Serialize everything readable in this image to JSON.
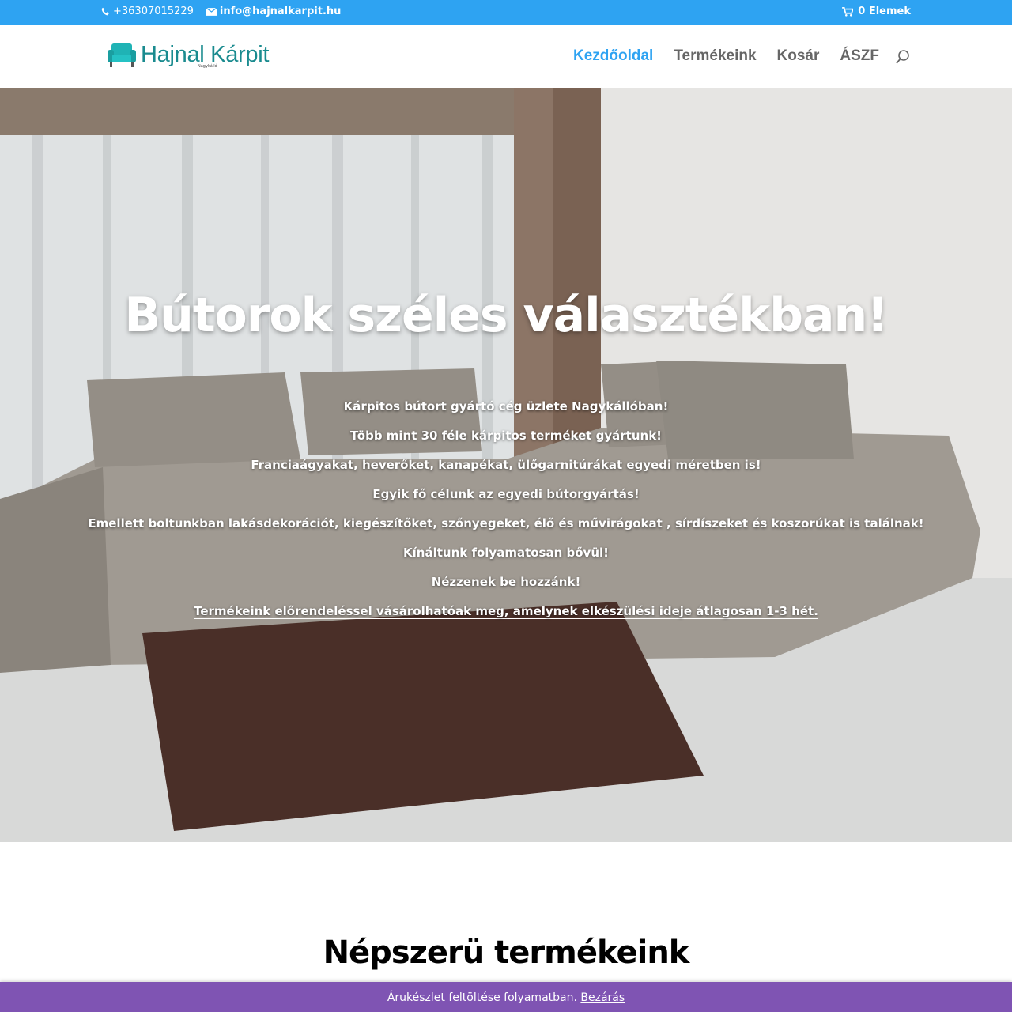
{
  "topbar": {
    "phone": "+36307015229",
    "email": "info@hajnalkarpit.hu",
    "cart_label": "0 Elemek",
    "phone_icon": "phone-icon",
    "email_icon": "envelope-icon",
    "cart_icon": "cart-icon"
  },
  "header": {
    "logo_text": "Hajnal Kárpit",
    "logo_subtext": "Nagykálló",
    "logo_icon": "armchair-icon",
    "nav": [
      {
        "label": "Kezdőoldal",
        "active": true
      },
      {
        "label": "Termékeink",
        "active": false
      },
      {
        "label": "Kosár",
        "active": false
      },
      {
        "label": "ÁSZF",
        "active": false
      }
    ],
    "search_icon": "search-icon"
  },
  "hero": {
    "title": "Bútorok széles választékban!",
    "lines": [
      "Kárpitos bútort gyártó cég üzlete Nagykállóban!",
      "Több mint 30 féle kárpitos terméket gyártunk!",
      "Franciaágyakat, heverőket, kanapékat, ülőgarnitúrákat egyedi méretben is!",
      "Egyik fő célunk az egyedi bútorgyártás!",
      "Emellett boltunkban lakásdekorációt, kiegészítőket,  szőnyegeket, élő és művirágokat , sírdíszeket és koszorúkat is találnak!",
      "Kínáltunk folyamatosan bővül!",
      "Nézzenek be hozzánk!",
      "Termékeink előrendeléssel vásárolhatóak meg, amelynek elkészülési ideje átlagosan 1-3 hét."
    ]
  },
  "section": {
    "title": "Népszerü termékeink"
  },
  "notice": {
    "text": "Árukészlet feltöltése folyamatban.",
    "dismiss_label": "Bezárás"
  },
  "colors": {
    "primary": "#2ea3f2",
    "notice_bg": "#7f54b3",
    "logo": "#1a8b8f"
  }
}
